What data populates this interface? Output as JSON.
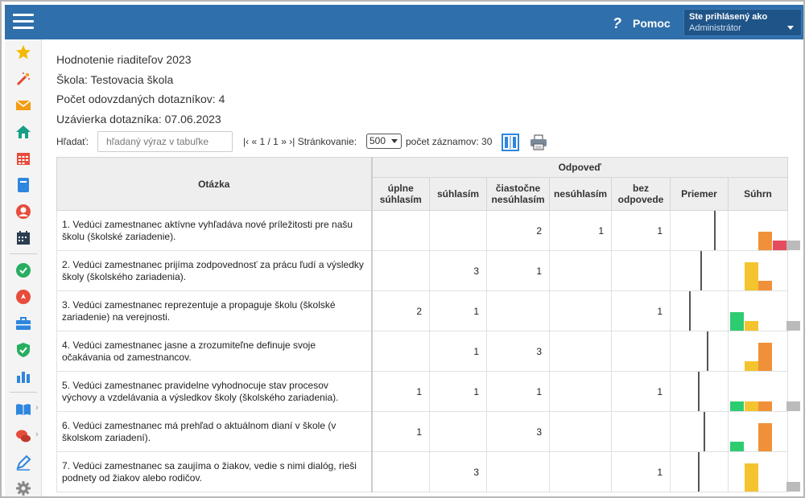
{
  "header": {
    "help_label": "Pomoc",
    "help_icon": "question-mark-icon",
    "user_line1": "Ste prihlásený ako",
    "user_line2": "Administrátor"
  },
  "sidebar": {
    "icons": [
      "star-icon",
      "magic-wand-icon",
      "envelope-icon",
      "home-icon",
      "calendar-grid-icon",
      "notebook-icon",
      "user-icon",
      "calendar-icon",
      "check-circle-icon",
      "location-pin-icon",
      "briefcase-icon",
      "shield-check-icon",
      "bar-chart-icon",
      "book-icon",
      "chat-icon",
      "pen-icon",
      "gear-icon"
    ]
  },
  "info": {
    "title": "Hodnotenie riaditeľov 2023",
    "school": "Škola: Testovacia škola",
    "submitted": "Počet odovzdaných dotazníkov: 4",
    "closing": "Uzávierka dotazníka: 07.06.2023"
  },
  "toolbar": {
    "search_label": "Hľadať:",
    "search_placeholder": "hľadaný výraz v tabuľke",
    "pager_first": "|‹",
    "pager_prev": "«",
    "pager_pos": "1 / 1",
    "pager_next": "»",
    "pager_last": "›|",
    "paging_label": "Stránkovanie:",
    "paging_value": "500",
    "records_label": "počet záznamov: 30"
  },
  "table": {
    "group_header": "Odpoveď",
    "col_question": "Otázka",
    "answer_cols": [
      "úplne súhlasím",
      "súhlasím",
      "čiastočne nesúhlasím",
      "nesúhlasím",
      "bez odpovede"
    ],
    "col_avg": "Priemer",
    "col_summary": "Súhrn",
    "colors": [
      "#2ecc71",
      "#f4c430",
      "#f0913a",
      "#e74c5e",
      "#bbbbbb"
    ],
    "rows": [
      {
        "q": "1. Vedúci zamestnanec aktívne vyhľadáva nové príležitosti pre našu školu (školské zariadenie).",
        "v": [
          "",
          "",
          "2",
          "1",
          "1"
        ],
        "counts": [
          0,
          0,
          2,
          1,
          1
        ],
        "avg": 3.33
      },
      {
        "q": "2. Vedúci zamestnanec prijíma zodpovednosť za prácu ľudí a výsledky školy (školského zariadenia).",
        "v": [
          "",
          "3",
          "1",
          "",
          ""
        ],
        "counts": [
          0,
          3,
          1,
          0,
          0
        ],
        "avg": 2.25
      },
      {
        "q": "3. Vedúci zamestnanec reprezentuje a propaguje školu (školské zariadenie) na verejnosti.",
        "v": [
          "2",
          "1",
          "",
          "",
          "1"
        ],
        "counts": [
          2,
          1,
          0,
          0,
          1
        ],
        "avg": 1.33
      },
      {
        "q": "4. Vedúci zamestnanec jasne a zrozumiteľne definuje svoje očakávania od zamestnancov.",
        "v": [
          "",
          "1",
          "3",
          "",
          ""
        ],
        "counts": [
          0,
          1,
          3,
          0,
          0
        ],
        "avg": 2.75
      },
      {
        "q": "5. Vedúci zamestnanec pravidelne vyhodnocuje stav procesov výchovy a vzdelávania a výsledkov školy (školského zariadenia).",
        "v": [
          "1",
          "1",
          "1",
          "",
          "1"
        ],
        "counts": [
          1,
          1,
          1,
          0,
          1
        ],
        "avg": 2.0
      },
      {
        "q": "6. Vedúci zamestnanec má prehľad o aktuálnom dianí v škole (v školskom zariadení).",
        "v": [
          "1",
          "",
          "3",
          "",
          ""
        ],
        "counts": [
          1,
          0,
          3,
          0,
          0
        ],
        "avg": 2.5
      },
      {
        "q": "7. Vedúci zamestnanec sa zaujíma o žiakov, vedie s nimi dialóg, rieši podnety od žiakov alebo rodičov.",
        "v": [
          "",
          "3",
          "",
          "",
          "1"
        ],
        "counts": [
          0,
          3,
          0,
          0,
          1
        ],
        "avg": 2.0
      }
    ]
  }
}
